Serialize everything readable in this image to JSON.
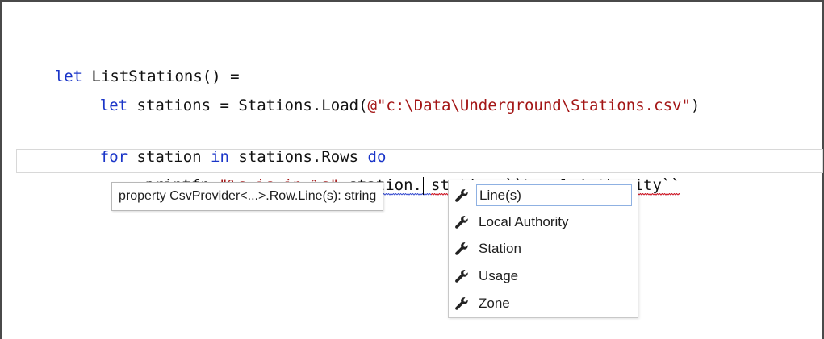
{
  "editor": {
    "lines": [
      {
        "kw1": "let",
        "text": " ListStations() ="
      },
      {
        "kw1": "let",
        "text": " stations = Stations.Load(",
        "str": "@\"c:\\Data\\Underground\\Stations.csv\"",
        "tail": ")"
      },
      {
        "kw1": "for",
        "mid": " station ",
        "kw2": "in",
        "text": " stations.Rows ",
        "kw3": "do"
      },
      {
        "fn": "printfn",
        "sp": " ",
        "str": "\"%s is in %s\"",
        "arg1": " station.",
        "arg2": "station.``Local Authority``"
      }
    ]
  },
  "tooltip": {
    "text": "property CsvProvider<...>.Row.Line(s): string"
  },
  "completion": {
    "items": [
      {
        "label": "Line(s)",
        "icon": "wrench-icon",
        "selected": true
      },
      {
        "label": "Local Authority",
        "icon": "wrench-icon",
        "selected": false
      },
      {
        "label": "Station",
        "icon": "wrench-icon",
        "selected": false
      },
      {
        "label": "Usage",
        "icon": "wrench-icon",
        "selected": false
      },
      {
        "label": "Zone",
        "icon": "wrench-icon",
        "selected": false
      }
    ]
  },
  "colors": {
    "keyword": "#1a35c8",
    "string": "#a31515",
    "selection_border": "#8fb1e2"
  }
}
